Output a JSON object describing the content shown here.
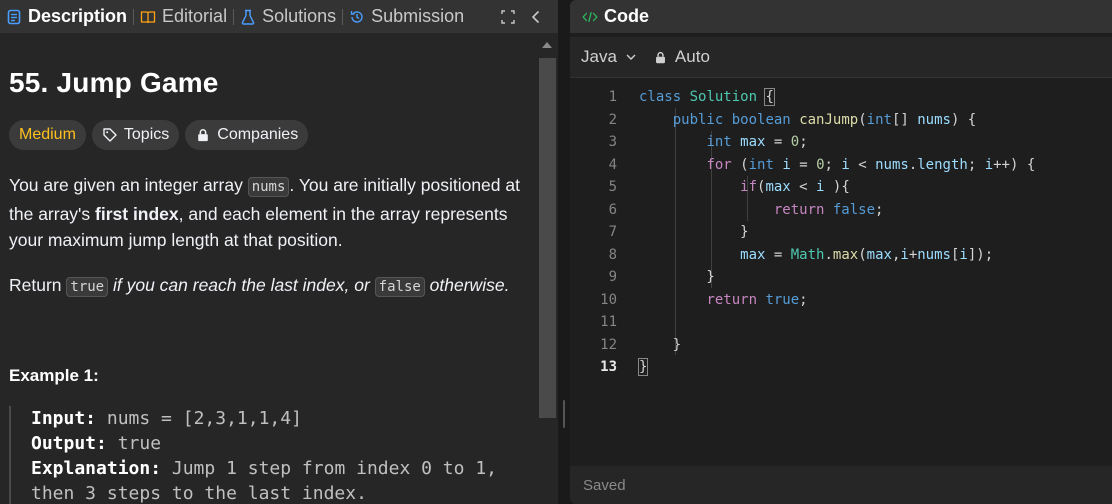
{
  "left_tabs": [
    {
      "label": "Description",
      "icon": "description-icon"
    },
    {
      "label": "Editorial",
      "icon": "book-icon"
    },
    {
      "label": "Solutions",
      "icon": "flask-icon"
    },
    {
      "label": "Submission",
      "icon": "history-icon"
    }
  ],
  "problem": {
    "title": "55. Jump Game",
    "difficulty": "Medium",
    "topics_label": "Topics",
    "companies_label": "Companies",
    "desc_part1": "You are given an integer array ",
    "nums_code": "nums",
    "desc_part2": ". You are initially positioned at the array's ",
    "desc_bold": "first index",
    "desc_part3": ", and each element in the array represents your maximum jump length at that position.",
    "return_word": "Return ",
    "true_code": "true",
    "return_italic1": " if you can reach the last index, or ",
    "false_code": "false",
    "return_italic2": " otherwise.",
    "example_title": "Example 1:",
    "input_label": "Input:",
    "input_value": " nums = [2,3,1,1,4]",
    "output_label": "Output:",
    "output_value": " true",
    "explanation_label": "Explanation:",
    "explanation_value": " Jump 1 step from index 0 to 1,",
    "explanation_cont": "then 3 steps to the last index."
  },
  "code_panel": {
    "title": "Code",
    "language": "Java",
    "mode": "Auto",
    "status": "Saved",
    "line_numbers": [
      "1",
      "2",
      "3",
      "4",
      "5",
      "6",
      "7",
      "8",
      "9",
      "10",
      "11",
      "12",
      "13"
    ],
    "lines": [
      "class Solution {",
      "    public boolean canJump(int[] nums) {",
      "        int max = 0;",
      "        for (int i = 0; i < nums.length; i++) {",
      "            if(max < i ){",
      "                return false;",
      "            }",
      "            max = Math.max(max,i+nums[i]);",
      "        }",
      "        return true;",
      "",
      "    }",
      "}"
    ]
  },
  "colors": {
    "accent_medium": "#ffc01e",
    "code_icon": "#2cbb5d",
    "keyword": "#569cd6"
  }
}
